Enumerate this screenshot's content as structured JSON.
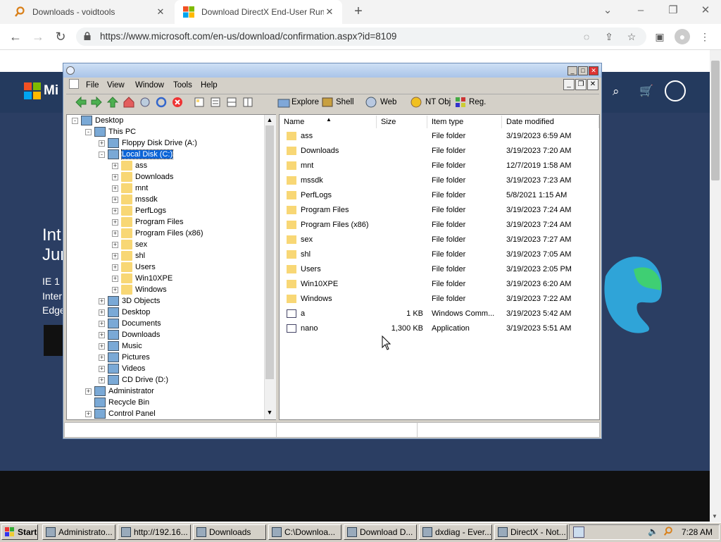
{
  "browser": {
    "tabs": [
      {
        "label": "Downloads - voidtools",
        "icon": "magnifier-icon",
        "active": false
      },
      {
        "label": "Download DirectX End-User Runtim",
        "icon": "microsoft-logo-icon",
        "active": true
      }
    ],
    "url": "https://www.microsoft.com/en-us/download/confirmation.aspx?id=8109"
  },
  "page": {
    "headline_1": "Int",
    "headline_2": "Jur",
    "line_1": "IE 1",
    "line_2": "Inter",
    "line_3": "Edge",
    "logo_text": "Mi"
  },
  "explorer": {
    "menu": [
      "File",
      "View",
      "Window",
      "Tools",
      "Help"
    ],
    "toolbar_labels": [
      "Explore",
      "Shell",
      "Web",
      "NT Obj",
      "Reg."
    ],
    "tree": [
      {
        "label": "Desktop",
        "level": 0,
        "exp": "-",
        "icon": "desktop-icon"
      },
      {
        "label": "This PC",
        "level": 1,
        "exp": "-",
        "icon": "computer-icon"
      },
      {
        "label": "Floppy Disk Drive (A:)",
        "level": 2,
        "exp": "+",
        "icon": "floppy-icon"
      },
      {
        "label": "Local Disk (C:)",
        "level": 2,
        "exp": "-",
        "icon": "drive-icon",
        "selected": true
      },
      {
        "label": "ass",
        "level": 3,
        "exp": "+",
        "icon": "folder-icon"
      },
      {
        "label": "Downloads",
        "level": 3,
        "exp": "+",
        "icon": "folder-icon"
      },
      {
        "label": "mnt",
        "level": 3,
        "exp": "+",
        "icon": "folder-icon"
      },
      {
        "label": "mssdk",
        "level": 3,
        "exp": "+",
        "icon": "folder-icon"
      },
      {
        "label": "PerfLogs",
        "level": 3,
        "exp": "+",
        "icon": "folder-icon"
      },
      {
        "label": "Program Files",
        "level": 3,
        "exp": "+",
        "icon": "folder-icon"
      },
      {
        "label": "Program Files (x86)",
        "level": 3,
        "exp": "+",
        "icon": "folder-icon"
      },
      {
        "label": "sex",
        "level": 3,
        "exp": "+",
        "icon": "folder-icon"
      },
      {
        "label": "shl",
        "level": 3,
        "exp": "+",
        "icon": "folder-icon"
      },
      {
        "label": "Users",
        "level": 3,
        "exp": "+",
        "icon": "folder-icon"
      },
      {
        "label": "Win10XPE",
        "level": 3,
        "exp": "+",
        "icon": "folder-icon"
      },
      {
        "label": "Windows",
        "level": 3,
        "exp": "+",
        "icon": "folder-icon"
      },
      {
        "label": "3D Objects",
        "level": 2,
        "exp": "+",
        "icon": "cube-icon"
      },
      {
        "label": "Desktop",
        "level": 2,
        "exp": "+",
        "icon": "desktop-icon"
      },
      {
        "label": "Documents",
        "level": 2,
        "exp": "+",
        "icon": "documents-icon"
      },
      {
        "label": "Downloads",
        "level": 2,
        "exp": "+",
        "icon": "download-arrow-icon"
      },
      {
        "label": "Music",
        "level": 2,
        "exp": "+",
        "icon": "music-icon"
      },
      {
        "label": "Pictures",
        "level": 2,
        "exp": "+",
        "icon": "pictures-icon"
      },
      {
        "label": "Videos",
        "level": 2,
        "exp": "+",
        "icon": "videos-icon"
      },
      {
        "label": "CD Drive (D:)",
        "level": 2,
        "exp": "+",
        "icon": "cd-icon"
      },
      {
        "label": "Administrator",
        "level": 1,
        "exp": "+",
        "icon": "user-icon"
      },
      {
        "label": "Recycle Bin",
        "level": 1,
        "exp": "",
        "icon": "recycle-bin-icon"
      },
      {
        "label": "Control Panel",
        "level": 1,
        "exp": "+",
        "icon": "control-panel-icon"
      }
    ],
    "columns": [
      "Name",
      "Size",
      "Item type",
      "Date modified"
    ],
    "files": [
      {
        "name": "ass",
        "size": "",
        "type": "File folder",
        "date": "3/19/2023 6:59 AM",
        "icon": "folder-icon"
      },
      {
        "name": "Downloads",
        "size": "",
        "type": "File folder",
        "date": "3/19/2023 7:20 AM",
        "icon": "folder-icon"
      },
      {
        "name": "mnt",
        "size": "",
        "type": "File folder",
        "date": "12/7/2019 1:58 AM",
        "icon": "folder-icon"
      },
      {
        "name": "mssdk",
        "size": "",
        "type": "File folder",
        "date": "3/19/2023 7:23 AM",
        "icon": "folder-icon"
      },
      {
        "name": "PerfLogs",
        "size": "",
        "type": "File folder",
        "date": "5/8/2021 1:15 AM",
        "icon": "folder-icon"
      },
      {
        "name": "Program Files",
        "size": "",
        "type": "File folder",
        "date": "3/19/2023 7:24 AM",
        "icon": "folder-icon"
      },
      {
        "name": "Program Files (x86)",
        "size": "",
        "type": "File folder",
        "date": "3/19/2023 7:24 AM",
        "icon": "folder-icon"
      },
      {
        "name": "sex",
        "size": "",
        "type": "File folder",
        "date": "3/19/2023 7:27 AM",
        "icon": "folder-icon"
      },
      {
        "name": "shl",
        "size": "",
        "type": "File folder",
        "date": "3/19/2023 7:05 AM",
        "icon": "folder-icon"
      },
      {
        "name": "Users",
        "size": "",
        "type": "File folder",
        "date": "3/19/2023 2:05 PM",
        "icon": "folder-icon"
      },
      {
        "name": "Win10XPE",
        "size": "",
        "type": "File folder",
        "date": "3/19/2023 6:20 AM",
        "icon": "folder-icon"
      },
      {
        "name": "Windows",
        "size": "",
        "type": "File folder",
        "date": "3/19/2023 7:22 AM",
        "icon": "folder-icon"
      },
      {
        "name": "a",
        "size": "1 KB",
        "type": "Windows Comm...",
        "date": "3/19/2023 5:42 AM",
        "icon": "script-file-icon"
      },
      {
        "name": "nano",
        "size": "1,300 KB",
        "type": "Application",
        "date": "3/19/2023 5:51 AM",
        "icon": "application-icon"
      }
    ]
  },
  "taskbar": {
    "start": "Start",
    "items": [
      "Administrato...",
      "http://192.16...",
      "Downloads",
      "C:\\Downloa...",
      "Download D...",
      "dxdiag - Ever...",
      "DirectX - Not..."
    ],
    "clock": "7:28 AM"
  },
  "colors": {
    "selection": "#0a64d8",
    "page_bg": "#2b3e63",
    "folder": "#f8d775"
  }
}
